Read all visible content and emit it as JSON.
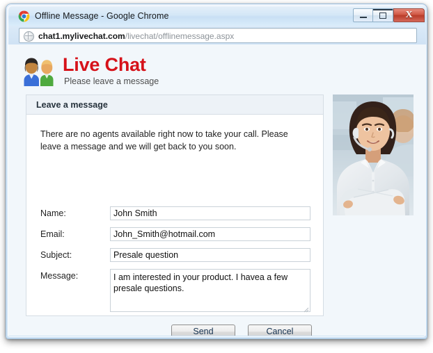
{
  "window": {
    "title": "Offline Message - Google Chrome",
    "app_icon": "chrome-logo-icon",
    "controls": {
      "minimize_label": "Minimize",
      "maximize_label": "Maximize",
      "close_label": "X"
    }
  },
  "address_bar": {
    "icon": "globe-page-icon",
    "url_host": "chat1.mylivechat.com",
    "url_path": "/livechat/offlinemessage.aspx",
    "full_url": "chat1.mylivechat.com/livechat/offlinemessage.aspx"
  },
  "site": {
    "logo_icon": "two-people-avatar-icon",
    "brand_title": "Live Chat",
    "brand_subtitle": "Please leave a message",
    "brand_color": "#d6121a"
  },
  "panel": {
    "header_title": "Leave a message",
    "intro_text": "There are no agents available right now to take your call. Please leave a message and we will get back to you soon."
  },
  "form": {
    "fields": [
      {
        "label": "Name:",
        "value": "John Smith",
        "placeholder": ""
      },
      {
        "label": "Email:",
        "value": "John_Smith@hotmail.com",
        "placeholder": ""
      },
      {
        "label": "Subject:",
        "value": "Presale question",
        "placeholder": ""
      }
    ],
    "message": {
      "label": "Message:",
      "value": "I am interested in your product. I havea a few presale questions.",
      "placeholder": ""
    },
    "buttons": {
      "send": "Send",
      "cancel": "Cancel"
    }
  },
  "media": {
    "agent_photo_alt": "support-agent-with-headset-photo"
  },
  "colors": {
    "page_background": "#f2f7fb",
    "panel_background": "#ffffff",
    "panel_border": "#d5dde4",
    "panel_header_background": "#edf2f7",
    "brand_red": "#d6121a",
    "close_button_red": "#c2503c",
    "title_bar_blue": "#d4e7f7"
  }
}
